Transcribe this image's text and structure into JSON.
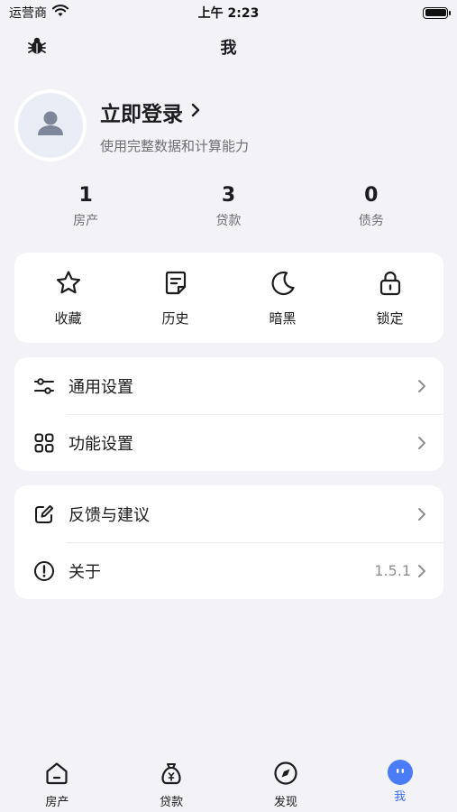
{
  "status_bar": {
    "carrier": "运营商",
    "time": "上午 2:23"
  },
  "nav": {
    "title": "我"
  },
  "profile": {
    "login_label": "立即登录",
    "subtitle": "使用完整数据和计算能力"
  },
  "stats": [
    {
      "value": "1",
      "label": "房产"
    },
    {
      "value": "3",
      "label": "贷款"
    },
    {
      "value": "0",
      "label": "债务"
    }
  ],
  "quick_actions": [
    {
      "label": "收藏",
      "icon": "star-icon"
    },
    {
      "label": "历史",
      "icon": "note-icon"
    },
    {
      "label": "暗黑",
      "icon": "moon-icon"
    },
    {
      "label": "锁定",
      "icon": "lock-icon"
    }
  ],
  "settings": [
    {
      "label": "通用设置",
      "icon": "sliders-icon"
    },
    {
      "label": "功能设置",
      "icon": "grid-icon"
    }
  ],
  "support": [
    {
      "label": "反馈与建议",
      "icon": "edit-icon",
      "value": ""
    },
    {
      "label": "关于",
      "icon": "info-icon",
      "value": "1.5.1"
    }
  ],
  "tabs": [
    {
      "label": "房产",
      "icon": "home-icon",
      "active": false
    },
    {
      "label": "贷款",
      "icon": "money-bag-icon",
      "active": false
    },
    {
      "label": "发现",
      "icon": "compass-icon",
      "active": false
    },
    {
      "label": "我",
      "icon": "profile-face-icon",
      "active": true
    }
  ],
  "colors": {
    "background": "#f2f2f7",
    "accent": "#4a7cf8",
    "text_primary": "#1c1c1e",
    "text_secondary": "#6e6e73"
  }
}
